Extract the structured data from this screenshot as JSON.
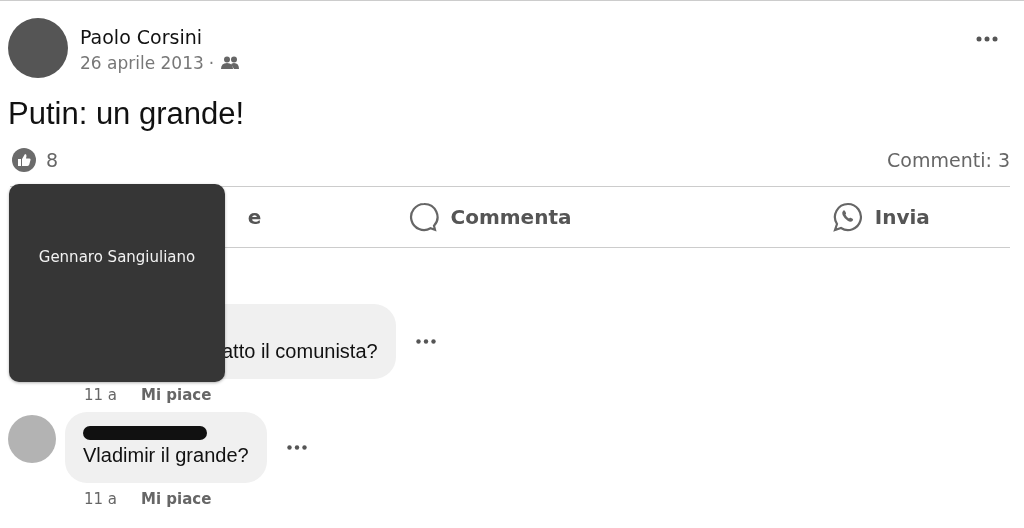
{
  "post": {
    "author": "Paolo Corsini",
    "date": "26 aprile 2013",
    "date_separator": "·",
    "text": "Putin: un grande!",
    "like_count": "8",
    "comments_count": "Commenti: 3"
  },
  "actions": [
    {
      "kind": "like",
      "label": "e"
    },
    {
      "kind": "comment",
      "label": "Commenta"
    },
    {
      "kind": "share",
      "label": "Invia"
    }
  ],
  "comments": [
    {
      "covered": true,
      "author_redacted": false,
      "text": "atto il comunista?",
      "time": "11 a",
      "like": "Mi piace"
    },
    {
      "covered": false,
      "author_redacted": true,
      "text": "Vladimir il grande?",
      "time": "11 a",
      "like": "Mi piace"
    }
  ],
  "tooltip": {
    "names": [
      "Gennaro Sangiuliano"
    ]
  }
}
